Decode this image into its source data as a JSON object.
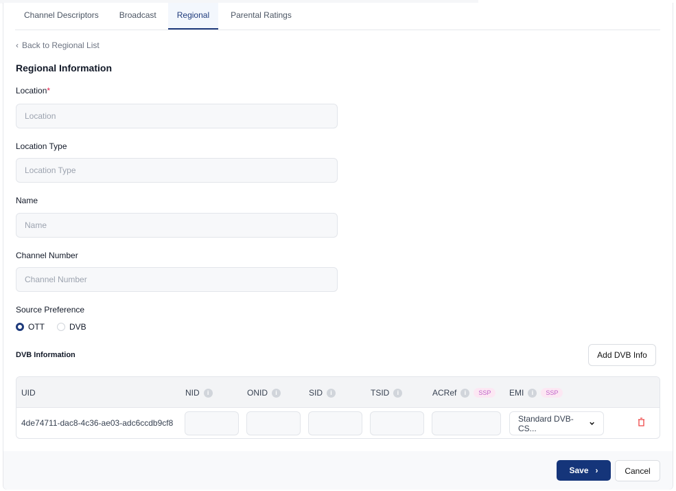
{
  "tabs": [
    {
      "label": "Channel Descriptors"
    },
    {
      "label": "Broadcast"
    },
    {
      "label": "Regional",
      "active": true
    },
    {
      "label": "Parental Ratings"
    }
  ],
  "back_link": "Back to Regional List",
  "section_title": "Regional Information",
  "fields": {
    "location": {
      "label": "Location",
      "required_mark": "*",
      "placeholder": "Location",
      "value": ""
    },
    "location_type": {
      "label": "Location Type",
      "placeholder": "Location Type",
      "value": ""
    },
    "name": {
      "label": "Name",
      "placeholder": "Name",
      "value": ""
    },
    "channel_number": {
      "label": "Channel Number",
      "placeholder": "Channel Number",
      "value": ""
    }
  },
  "source_preference": {
    "label": "Source Preference",
    "options": [
      "OTT",
      "DVB"
    ],
    "selected": "OTT"
  },
  "dvb": {
    "title": "DVB Information",
    "add_button": "Add DVB Info",
    "columns": {
      "uid": "UID",
      "nid": "NID",
      "onid": "ONID",
      "sid": "SID",
      "tsid": "TSID",
      "acref": "ACRef",
      "emi": "EMI"
    },
    "badge": "SSP",
    "info_glyph": "i",
    "rows": [
      {
        "uid": "4de74711-dac8-4c36-ae03-adc6ccdb9cf8",
        "nid": "",
        "onid": "",
        "sid": "",
        "tsid": "",
        "acref": "",
        "emi": "Standard DVB-CS..."
      }
    ]
  },
  "footer": {
    "save": "Save",
    "cancel": "Cancel"
  },
  "colors": {
    "primary": "#15357a",
    "danger": "#ef4444",
    "badge_bg": "#fce7f3"
  }
}
